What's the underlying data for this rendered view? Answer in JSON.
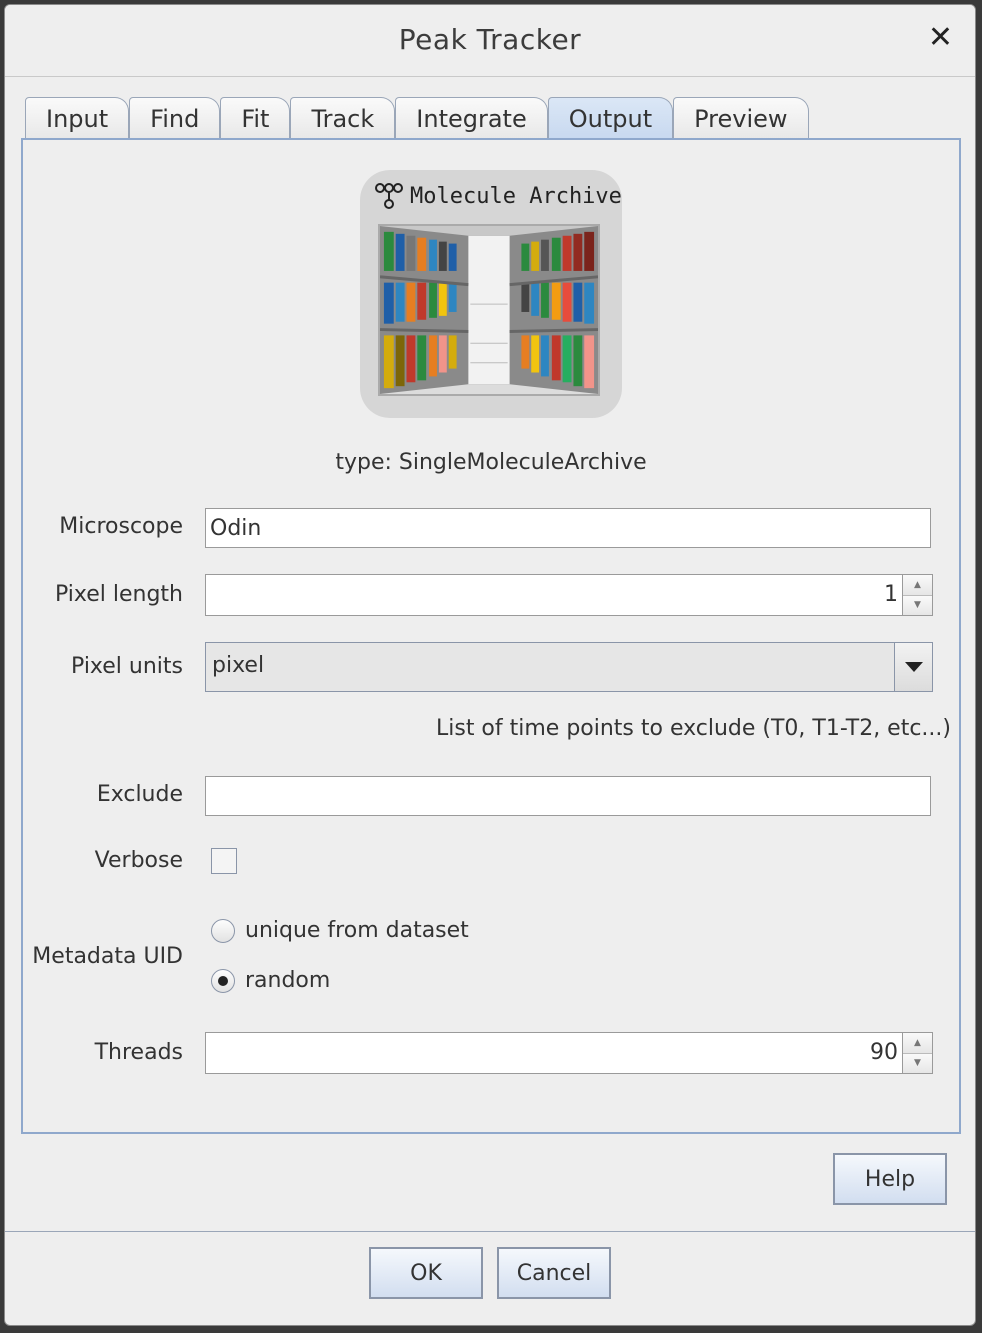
{
  "window": {
    "title": "Peak Tracker",
    "close_glyph": "✕"
  },
  "tabs": [
    {
      "label": "Input"
    },
    {
      "label": "Find"
    },
    {
      "label": "Fit"
    },
    {
      "label": "Track"
    },
    {
      "label": "Integrate"
    },
    {
      "label": "Output",
      "active": true
    },
    {
      "label": "Preview"
    }
  ],
  "logo": {
    "title": "Molecule Archive"
  },
  "type_line": "type: SingleMoleculeArchive",
  "form": {
    "microscope": {
      "label": "Microscope",
      "value": "Odin"
    },
    "pixel_length": {
      "label": "Pixel length",
      "value": "1"
    },
    "pixel_units": {
      "label": "Pixel units",
      "value": "pixel"
    },
    "exclude_hint": "List of time points to exclude (T0, T1-T2, etc...)",
    "exclude": {
      "label": "Exclude",
      "value": ""
    },
    "verbose": {
      "label": "Verbose",
      "checked": false
    },
    "metadata_uid": {
      "label": "Metadata UID",
      "options": [
        {
          "label": "unique from dataset",
          "selected": false
        },
        {
          "label": "random",
          "selected": true
        }
      ]
    },
    "threads": {
      "label": "Threads",
      "value": "90"
    }
  },
  "buttons": {
    "help": "Help",
    "ok": "OK",
    "cancel": "Cancel"
  },
  "colors": {
    "active_tab": "#c7d8ef",
    "panel_border": "#8fa8cc",
    "window_bg": "#eeeeee"
  }
}
